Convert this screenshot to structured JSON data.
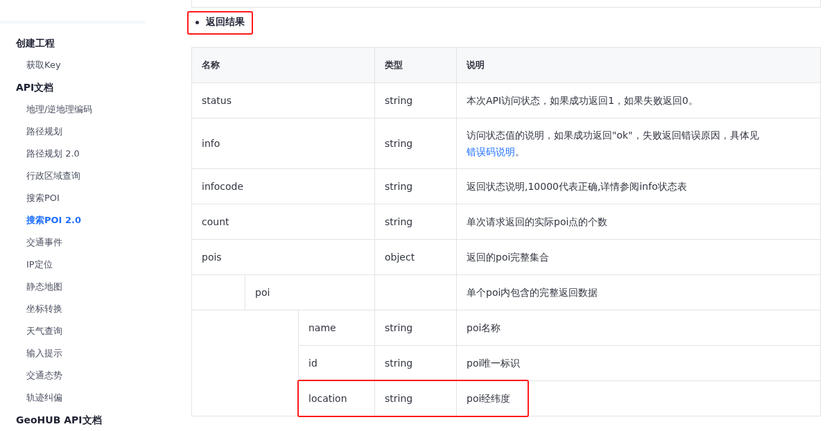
{
  "sidebar": {
    "sections": [
      {
        "label": "创建工程",
        "items": [
          {
            "label": "获取Key",
            "selected": false
          }
        ]
      },
      {
        "label": "API文档",
        "items": [
          {
            "label": "地理/逆地理编码",
            "selected": false
          },
          {
            "label": "路径规划",
            "selected": false
          },
          {
            "label": "路径规划 2.0",
            "selected": false
          },
          {
            "label": "行政区域查询",
            "selected": false
          },
          {
            "label": "搜索POI",
            "selected": false
          },
          {
            "label": "搜索POI 2.0",
            "selected": true
          },
          {
            "label": "交通事件",
            "selected": false
          },
          {
            "label": "IP定位",
            "selected": false
          },
          {
            "label": "静态地图",
            "selected": false
          },
          {
            "label": "坐标转换",
            "selected": false
          },
          {
            "label": "天气查询",
            "selected": false
          },
          {
            "label": "输入提示",
            "selected": false
          },
          {
            "label": "交通态势",
            "selected": false
          },
          {
            "label": "轨迹纠偏",
            "selected": false
          }
        ]
      },
      {
        "label": "GeoHUB API文档"
      }
    ]
  },
  "content": {
    "heading": {
      "text": "返回结果",
      "highlighted": true
    },
    "table": {
      "columns": [
        "名称",
        "类型",
        "说明"
      ],
      "rows": [
        {
          "name": "status",
          "type": "string",
          "description": {
            "text": "本次API访问状态，如果成功返回1，如果失败返回0。"
          },
          "highlighted": false
        },
        {
          "name": "info",
          "type": "string",
          "description": {
            "text": "访问状态值的说明，如果成功返回\"ok\"，失败返回错误原因，具体见",
            "link": "错误码说明",
            "tail": "。"
          },
          "highlighted": false
        },
        {
          "name": "infocode",
          "type": "string",
          "description": {
            "text": "返回状态说明,10000代表正确,详情参阅info状态表"
          },
          "highlighted": false
        },
        {
          "name": "count",
          "type": "string",
          "description": {
            "text": "单次请求返回的实际poi点的个数"
          },
          "highlighted": false
        },
        {
          "name": "pois",
          "type": "object",
          "description": {
            "text": "返回的poi完整集合"
          },
          "highlighted": false,
          "children": [
            {
              "name": "poi",
              "description": {
                "text": "单个poi内包含的完整返回数据"
              },
              "highlighted": false,
              "children": [
                {
                  "name": "name",
                  "type": "string",
                  "description": {
                    "text": "poi名称"
                  },
                  "highlighted": false
                },
                {
                  "name": "id",
                  "type": "string",
                  "description": {
                    "text": "poi唯一标识"
                  },
                  "highlighted": false
                },
                {
                  "name": "location",
                  "type": "string",
                  "description": {
                    "text": "poi经纬度"
                  },
                  "highlighted": true
                }
              ]
            }
          ]
        }
      ]
    }
  }
}
